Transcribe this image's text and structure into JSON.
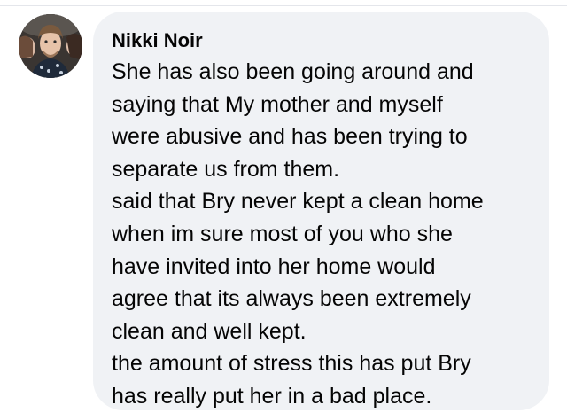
{
  "comment": {
    "author": "Nikki Noir",
    "lines": [
      "She has also been going around and",
      "saying that My mother and myself",
      "were abusive and has been trying to",
      "separate us from them.",
      "said that Bry never kept a clean home",
      "when im sure most of you who she",
      "have invited into her home would",
      "agree that its always been extremely",
      "clean and well kept.",
      "the amount of stress this has put Bry",
      "has really put her in a bad place."
    ]
  },
  "colors": {
    "bubble_background": "#f0f2f5",
    "text": "#050505"
  }
}
